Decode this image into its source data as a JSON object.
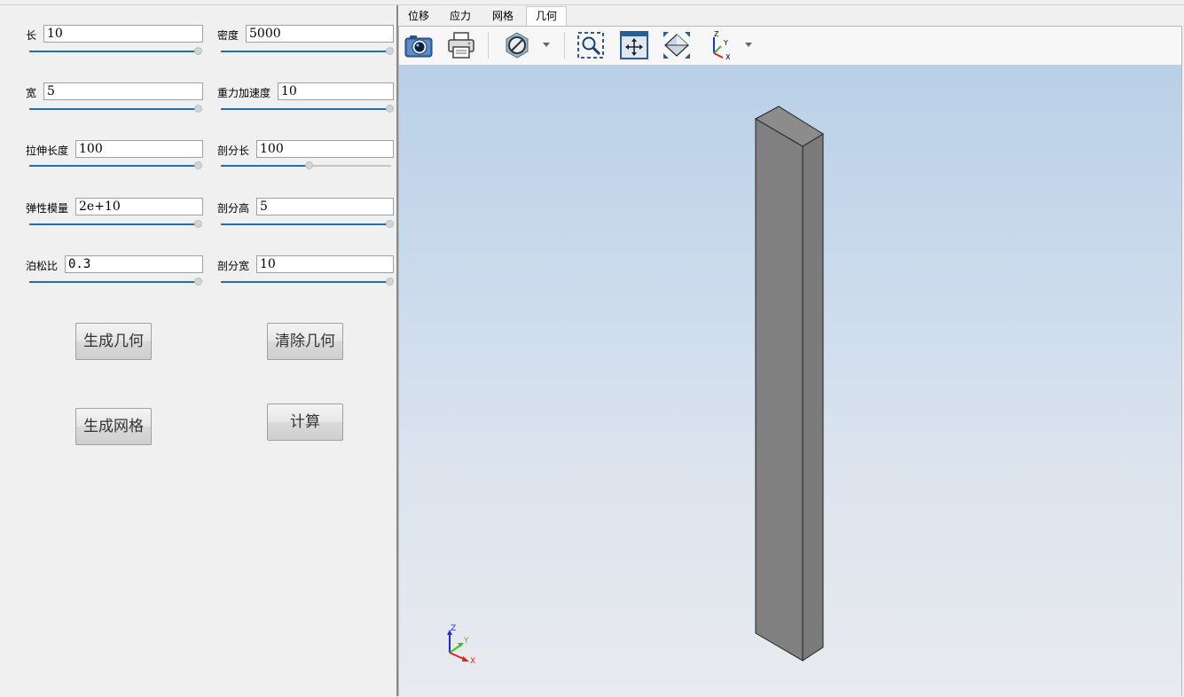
{
  "params_left": [
    {
      "label": "长",
      "value": "10",
      "slider": 1.0
    },
    {
      "label": "宽",
      "value": "5",
      "slider": 1.0
    },
    {
      "label": "拉伸长度",
      "value": "100",
      "slider": 1.0
    },
    {
      "label": "弹性模量",
      "value": "2e+10",
      "slider": 1.0
    },
    {
      "label": "泊松比",
      "value": "0.3",
      "slider": 1.0
    }
  ],
  "params_right": [
    {
      "label": "密度",
      "value": "5000",
      "slider": 1.0
    },
    {
      "label": "重力加速度",
      "value": "10",
      "slider": 1.0
    },
    {
      "label": "剖分长",
      "value": "100",
      "slider": 0.52
    },
    {
      "label": "剖分高",
      "value": "5",
      "slider": 1.0
    },
    {
      "label": "剖分宽",
      "value": "10",
      "slider": 1.0
    }
  ],
  "buttons": {
    "generate_geometry": "生成几何",
    "clear_geometry": "清除几何",
    "generate_mesh": "生成网格",
    "compute": "计算"
  },
  "tabs": [
    {
      "label": "位移",
      "active": false
    },
    {
      "label": "应力",
      "active": false
    },
    {
      "label": "网格",
      "active": false
    },
    {
      "label": "几何",
      "active": true
    }
  ],
  "toolbar": {
    "icons": [
      "camera-icon",
      "print-icon",
      "hide-icon",
      "zoom-region-icon",
      "fit-view-icon",
      "iso-view-icon",
      "axes-view-icon"
    ]
  },
  "axes_triad": {
    "z": "Z",
    "y": "Y",
    "x": "X"
  },
  "colors": {
    "slider_fill": "#1f6fb5",
    "beam_front": "#808080",
    "beam_side": "#7a7a7a",
    "beam_top": "#8c8c8c",
    "axis_x": "#e2231a",
    "axis_y": "#3bbf2a",
    "axis_z": "#1c2fd6"
  }
}
